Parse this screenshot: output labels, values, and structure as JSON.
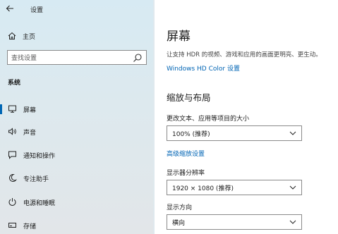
{
  "window": {
    "title": "设置"
  },
  "sidebar": {
    "home_label": "主页",
    "search_placeholder": "查找设置",
    "section": "系统",
    "items": [
      {
        "label": "屏幕",
        "icon": "monitor-icon",
        "selected": true
      },
      {
        "label": "声音",
        "icon": "speaker-icon",
        "selected": false
      },
      {
        "label": "通知和操作",
        "icon": "notification-icon",
        "selected": false
      },
      {
        "label": "专注助手",
        "icon": "moon-icon",
        "selected": false
      },
      {
        "label": "电源和睡眠",
        "icon": "power-icon",
        "selected": false
      },
      {
        "label": "存储",
        "icon": "storage-icon",
        "selected": false
      }
    ]
  },
  "main": {
    "title": "屏幕",
    "hdr_desc": "让支持 HDR 的视频、游戏和应用的画面更明亮、更生动。",
    "hdr_link": "Windows HD Color 设置",
    "scale_section": "缩放与布局",
    "scale_label": "更改文本、应用等项目的大小",
    "scale_value": "100% (推荐)",
    "advanced_scale_link": "高级缩放设置",
    "resolution_label": "显示器分辨率",
    "resolution_value": "1920 × 1080 (推荐)",
    "orientation_label": "显示方向",
    "orientation_value": "横向"
  },
  "colors": {
    "accent": "#0064b4",
    "sidebar_bg": "#dde9ee"
  }
}
